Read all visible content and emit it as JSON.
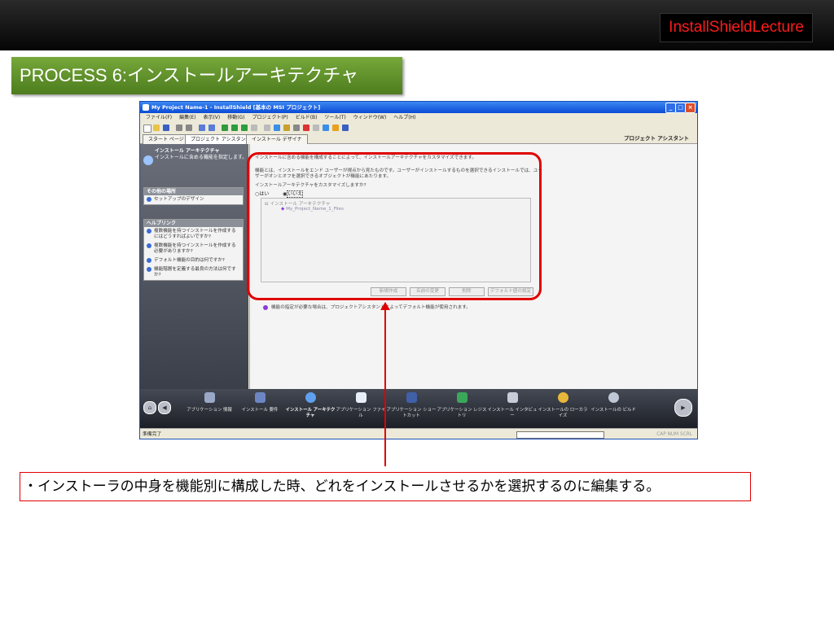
{
  "header": {
    "brand": "InstallShieldLecture"
  },
  "process_title": "PROCESS 6:インストールアーキテクチャ",
  "window": {
    "title": "My Project Name-1 - InstallShield [基本の MSI プロジェクト]",
    "menu": [
      "ファイル(F)",
      "編集(E)",
      "表示(V)",
      "移動(G)",
      "プロジェクト(P)",
      "ビルド(B)",
      "ツール(T)",
      "ウィンドウ(W)",
      "ヘルプ(H)"
    ],
    "tabs": [
      "スタート ページ",
      "プロジェクト アシスタント",
      "インストール デザイナ"
    ],
    "assistant_label": "プロジェクト アシスタント",
    "left": {
      "heading_title": "インストール アーキテクチャ",
      "heading_sub": "インストールに含める機能を指定します。",
      "other_header": "その他の場所",
      "other_items": [
        "セットアップのデザイン"
      ],
      "help_header": "ヘルプリンク",
      "help_items": [
        "複数機能を持つインストールを作成するにはどうすればよいですか?",
        "複数機能を持つインストールを作成する必要がありますか?",
        "デフォルト機能の目的は何ですか?",
        "機能階層を定義する最良の方法は何ですか?"
      ]
    },
    "main": {
      "intro": "インストールに含める機能を構成することによって、インストールアーキテクチャをカスタマイズできます。",
      "desc1": "機能とは、インストールをエンド ユーザーが視点から見たものです。ユーザーがインストールするものを選択できるインストールでは、ユー",
      "desc2": "ザーがオンとオフを選択できるオブジェクトが機能にあたります。",
      "question": "インストールアーキテクチャをカスタマイズしますか?",
      "radio_yes": "はい",
      "radio_no": "いいえ",
      "tree_root": "インストール アーキテクチャ",
      "tree_child": "My_Project_Name_1_Files",
      "buttons": [
        "新規作成",
        "名前の変更",
        "削除",
        "デフォルト値の設定"
      ],
      "note": "機能の指定が必要な場合は、プロジェクトアシスタントによってデフォルト機能が使用されます。"
    },
    "bottom_nav": [
      "アプリケーション 情報",
      "インストール 要件",
      "インストール アーキテクチャ",
      "アプリケーション ファイル",
      "アプリケーション ショートカット",
      "アプリケーション レジストリ",
      "インストール インタビュー",
      "インストールの ローカライズ",
      "インストールの ビルド"
    ],
    "status": {
      "ready": "準備完了",
      "keys": "CAP  NUM  SCRL"
    }
  },
  "caption": "・インストーラの中身を機能別に構成した時、どれをインストールさせるかを選択するのに編集する。",
  "colors": {
    "accent_red": "#e00000",
    "process_green": "#5f9129",
    "brand_red": "#ff1a1a"
  }
}
